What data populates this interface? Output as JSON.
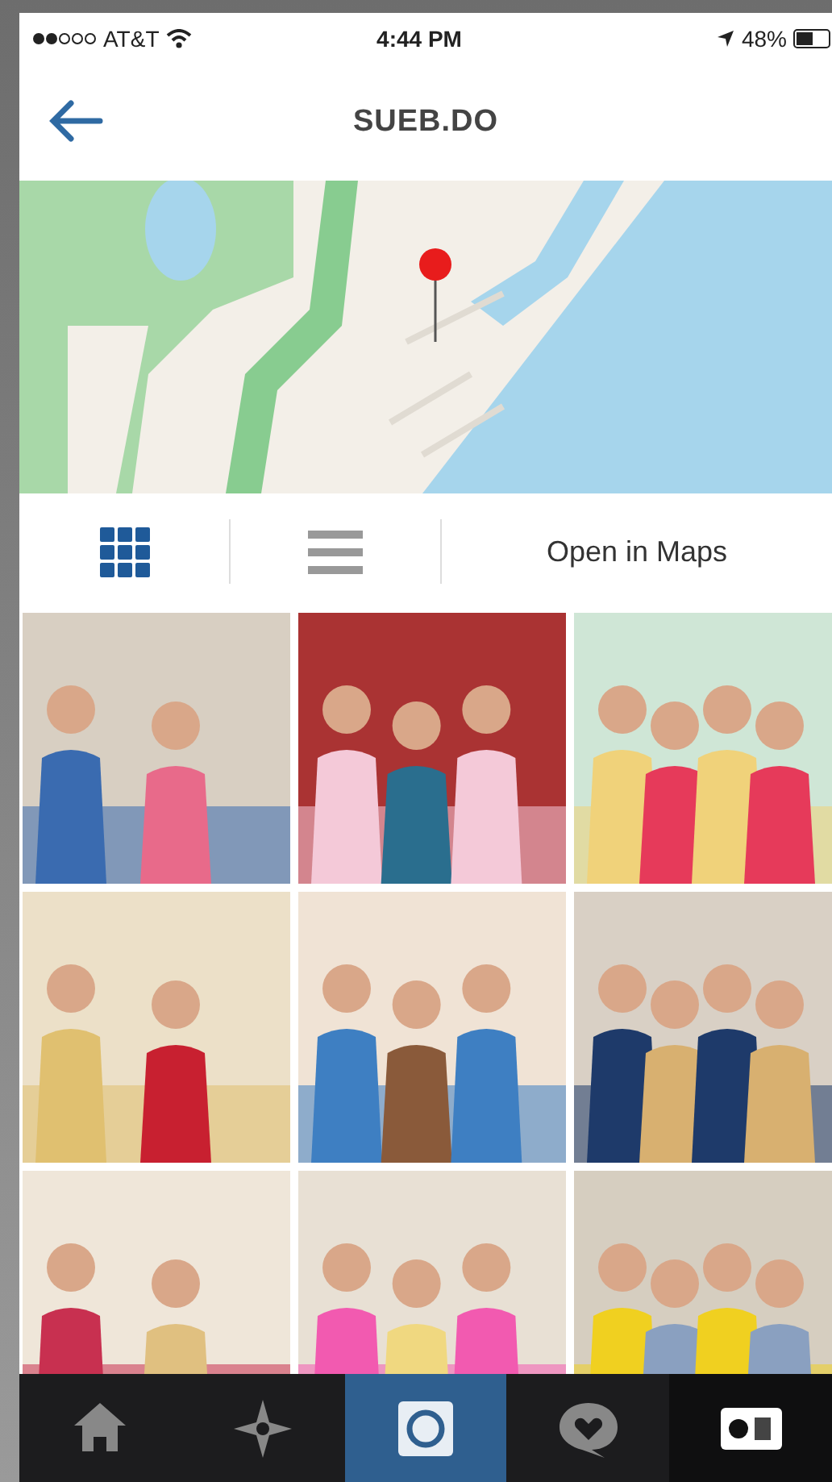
{
  "status_bar": {
    "carrier": "AT&T",
    "time": "4:44 PM",
    "battery": "48%"
  },
  "header": {
    "title": "SUEB.DO"
  },
  "view_tabs": [
    {
      "kind": "grid",
      "selected": true
    },
    {
      "kind": "list",
      "selected": false
    }
  ],
  "open_in_maps": "Open in Maps",
  "tab_bar": [
    {
      "kind": "home",
      "selected": false
    },
    {
      "kind": "explore",
      "selected": false
    },
    {
      "kind": "camera",
      "selected": false
    },
    {
      "kind": "activity",
      "selected": false
    },
    {
      "kind": "profile",
      "selected": true
    }
  ]
}
